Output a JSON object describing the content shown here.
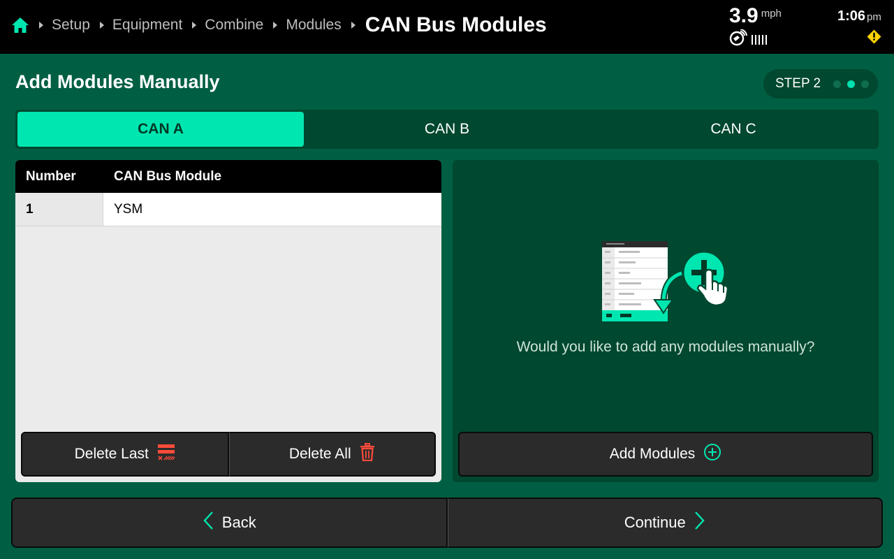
{
  "breadcrumb": {
    "items": [
      "Setup",
      "Equipment",
      "Combine",
      "Modules"
    ],
    "current": "CAN Bus Modules"
  },
  "status": {
    "speed_value": "3.9",
    "speed_unit": "mph",
    "time": "1:06",
    "ampm": "pm"
  },
  "page": {
    "title": "Add Modules Manually",
    "step_label": "STEP 2",
    "step_total": 3,
    "step_current": 2
  },
  "tabs": [
    {
      "label": "CAN A",
      "active": true
    },
    {
      "label": "CAN B",
      "active": false
    },
    {
      "label": "CAN C",
      "active": false
    }
  ],
  "table": {
    "columns": [
      "Number",
      "CAN Bus Module"
    ],
    "rows": [
      {
        "number": "1",
        "module": "YSM"
      }
    ]
  },
  "left_actions": {
    "delete_last": "Delete Last",
    "delete_all": "Delete All"
  },
  "right_panel": {
    "prompt": "Would you like to add any modules manually?",
    "add_button": "Add Modules"
  },
  "footer": {
    "back": "Back",
    "continue": "Continue"
  },
  "colors": {
    "background": "#005f43",
    "panel_dark": "#00482f",
    "accent": "#00e6b0",
    "danger": "#ff4b3a",
    "warning": "#ffd400"
  }
}
